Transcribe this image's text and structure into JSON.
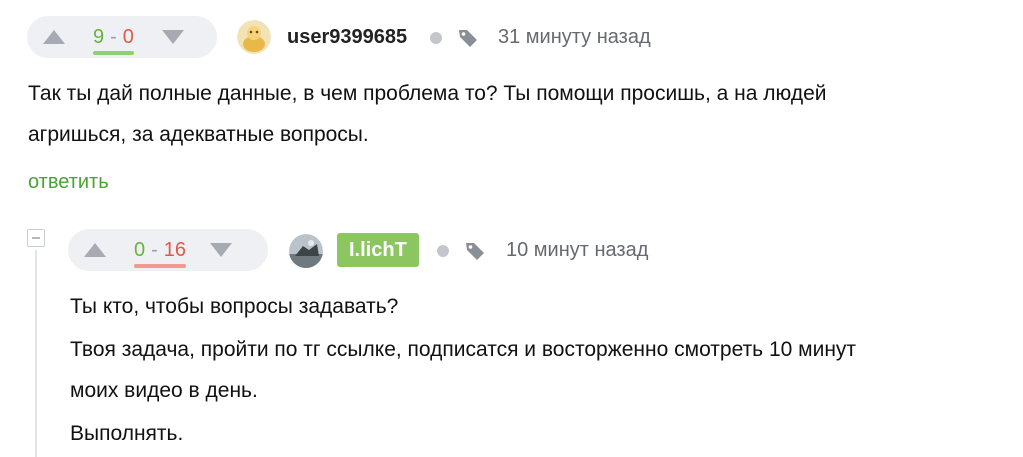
{
  "comments": [
    {
      "votes": {
        "plus": "9",
        "separator": "-",
        "minus": "0",
        "positive_ratio": 1.0
      },
      "author": "user9399685",
      "time": "31 минуту назад",
      "text_lines": [
        "Так ты дай полные данные, в чем проблема то? Ты помощи просишь, а на людей",
        "агришься, за адекватные вопросы."
      ],
      "reply_label": "ответить"
    },
    {
      "votes": {
        "plus": "0",
        "separator": "-",
        "minus": "16",
        "positive_ratio": 0.0
      },
      "author": "I.lichT",
      "time": "10 минут назад",
      "text_lines": [
        "Ты кто, чтобы вопросы задавать?",
        "Твоя задача, пройти по тг ссылке, подписатся и восторженно смотреть 10 минут",
        "моих видео в день.",
        "Выполнять."
      ]
    }
  ],
  "colors": {
    "positive": "#68b43b",
    "negative": "#e15a47",
    "author_badge": "#8cc660",
    "link": "#4aa236"
  }
}
